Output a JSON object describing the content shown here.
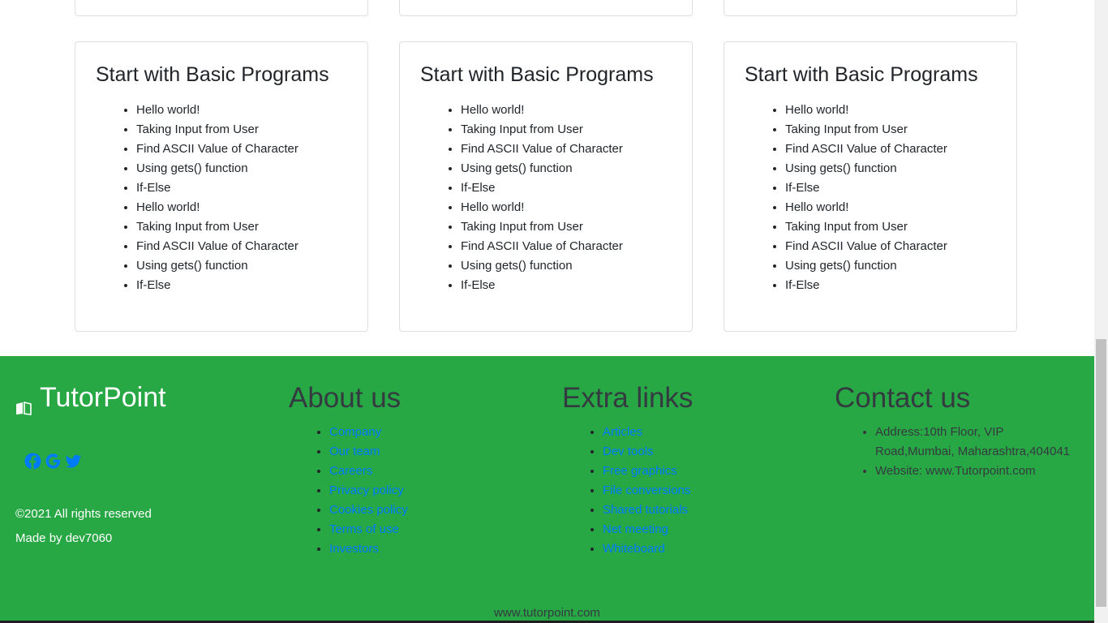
{
  "cards": [
    {
      "title": "Start with Basic Programs",
      "items": [
        "Hello world!",
        "Taking Input from User",
        "Find ASCII Value of Character",
        "Using gets() function",
        "If-Else",
        "Hello world!",
        "Taking Input from User",
        "Find ASCII Value of Character",
        "Using gets() function",
        "If-Else"
      ]
    },
    {
      "title": "Start with Basic Programs",
      "items": [
        "Hello world!",
        "Taking Input from User",
        "Find ASCII Value of Character",
        "Using gets() function",
        "If-Else",
        "Hello world!",
        "Taking Input from User",
        "Find ASCII Value of Character",
        "Using gets() function",
        "If-Else"
      ]
    },
    {
      "title": "Start with Basic Programs",
      "items": [
        "Hello world!",
        "Taking Input from User",
        "Find ASCII Value of Character",
        "Using gets() function",
        "If-Else",
        "Hello world!",
        "Taking Input from User",
        "Find ASCII Value of Character",
        "Using gets() function",
        "If-Else"
      ]
    }
  ],
  "footer": {
    "brand": "TutorPoint",
    "brand_icon": "book-icon",
    "social_icons": [
      "facebook-icon",
      "google-icon",
      "twitter-icon"
    ],
    "copyright": "©2021 All rights reserved",
    "made_by": "Made by dev7060",
    "about": {
      "heading": "About us",
      "links": [
        "Company",
        "Our team",
        "Careers",
        "Privacy policy",
        "Cookies policy",
        "Terms of use",
        "Investors"
      ]
    },
    "extra": {
      "heading": "Extra links",
      "links": [
        "Articles",
        "Dev tools",
        "Free graphics",
        "File conversions",
        "Shared tutorials",
        "Net meeting",
        "Whiteboard"
      ]
    },
    "contact": {
      "heading": "Contact us",
      "items": [
        "Address:10th Floor, VIP Road,Mumbai, Maharashtra,404041",
        "Website: www.Tutorpoint.com"
      ]
    },
    "site": "www.tutorpoint.com"
  },
  "colors": {
    "footer_bg": "#28a745",
    "link": "#007bff",
    "social": "#007bff"
  }
}
